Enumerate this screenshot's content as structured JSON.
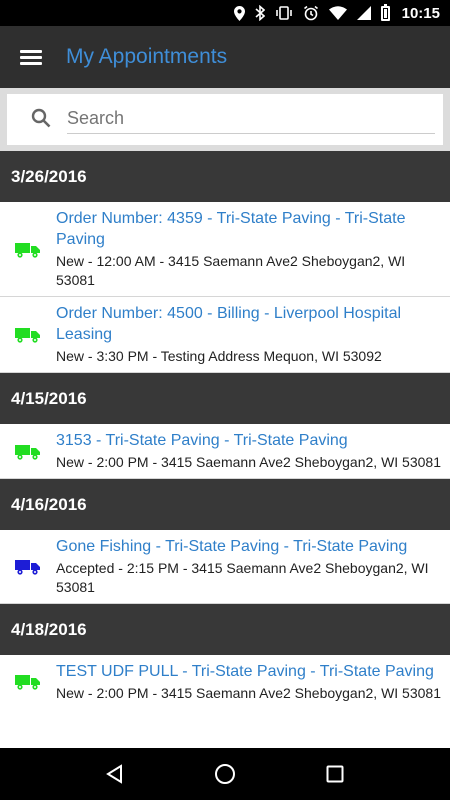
{
  "status_bar": {
    "time": "10:15"
  },
  "app_bar": {
    "title": "My Appointments"
  },
  "search": {
    "placeholder": "Search",
    "value": ""
  },
  "colors": {
    "accent": "#3f8ed8",
    "header_bg": "#383838",
    "truck_new": "#22dd22",
    "truck_accepted": "#1d1dd6"
  },
  "groups": [
    {
      "date": "3/26/2016",
      "items": [
        {
          "title": "Order Number: 4359 - Tri-State Paving - Tri-State Paving",
          "detail": "New - 12:00 AM - 3415 Saemann Ave2 Sheboygan2, WI 53081",
          "status": "new",
          "icon": "truck-icon"
        },
        {
          "title": "Order Number: 4500 - Billing - Liverpool Hospital Leasing",
          "detail": "New - 3:30 PM - Testing Address Mequon, WI 53092",
          "status": "new",
          "icon": "truck-icon"
        }
      ]
    },
    {
      "date": "4/15/2016",
      "items": [
        {
          "title": "3153 - Tri-State Paving - Tri-State Paving",
          "detail": "New - 2:00 PM - 3415 Saemann Ave2 Sheboygan2, WI 53081",
          "status": "new",
          "icon": "truck-icon"
        }
      ]
    },
    {
      "date": "4/16/2016",
      "items": [
        {
          "title": "Gone Fishing - Tri-State Paving - Tri-State Paving",
          "detail": "Accepted - 2:15 PM - 3415 Saemann Ave2 Sheboygan2, WI 53081",
          "status": "accepted",
          "icon": "truck-icon"
        }
      ]
    },
    {
      "date": "4/18/2016",
      "items": [
        {
          "title": "TEST UDF PULL - Tri-State Paving - Tri-State Paving",
          "detail": "New - 2:00 PM - 3415 Saemann Ave2 Sheboygan2, WI 53081",
          "status": "new",
          "icon": "truck-icon"
        }
      ]
    }
  ],
  "nav": {
    "back_icon": "back-triangle-icon",
    "home_icon": "home-circle-icon",
    "recents_icon": "recents-square-icon"
  }
}
